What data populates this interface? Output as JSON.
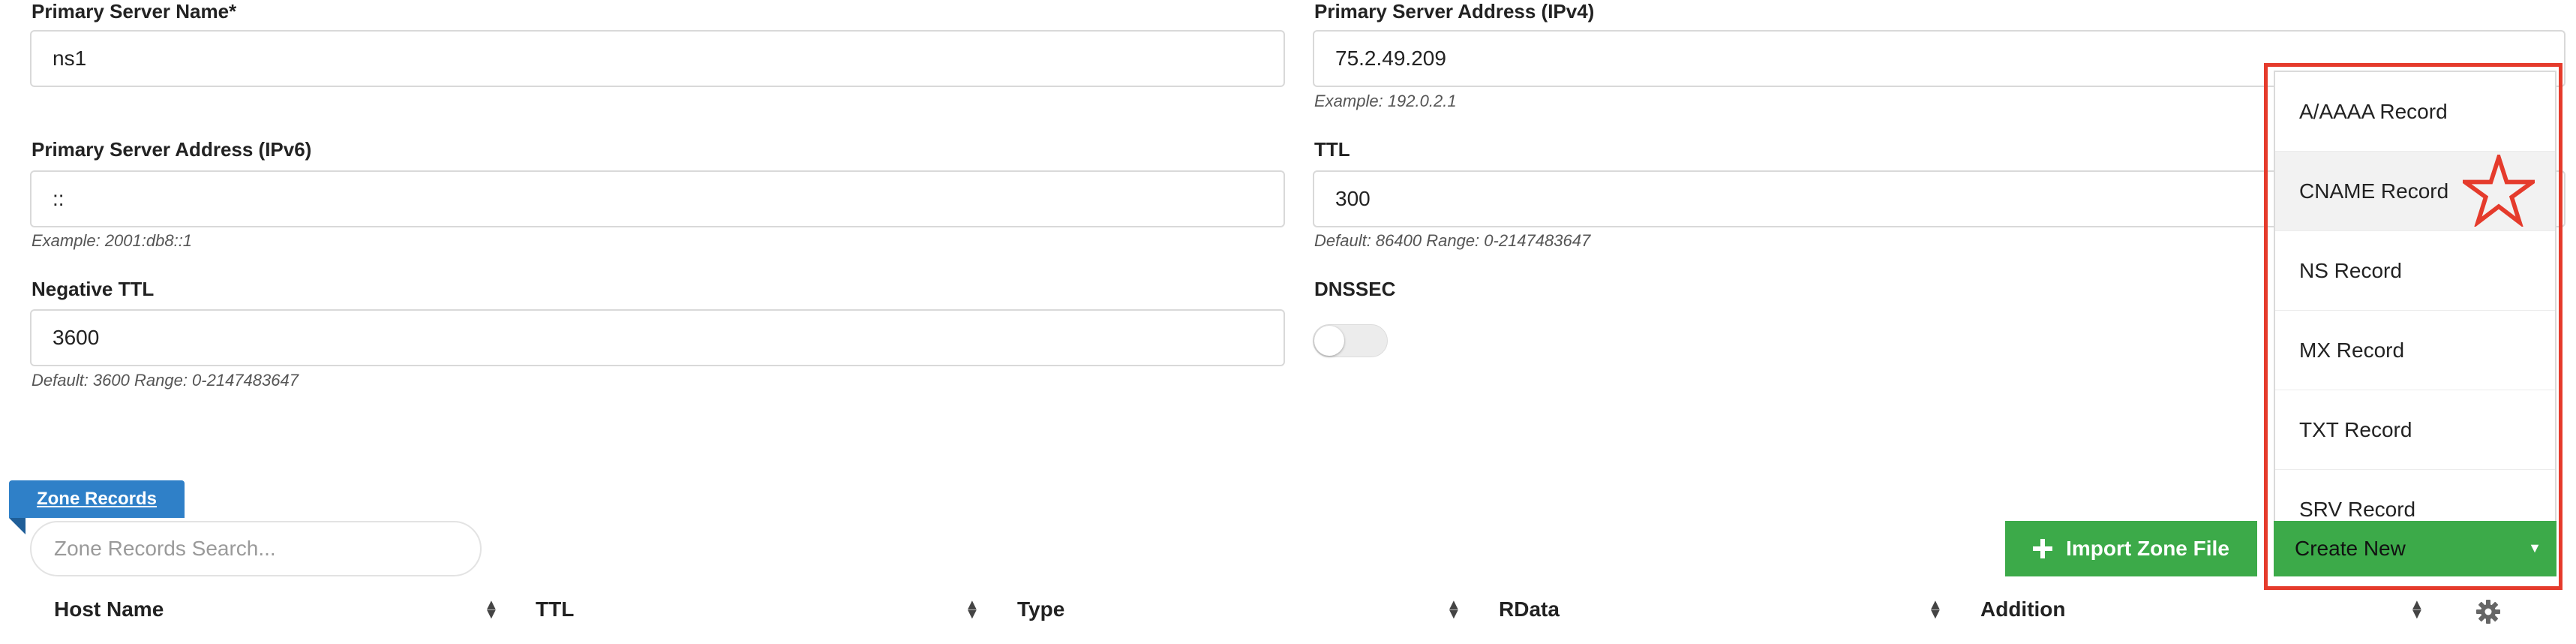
{
  "fields": {
    "primary_name": {
      "label": "Primary Server Name*",
      "value": "ns1"
    },
    "ipv4": {
      "label": "Primary Server Address (IPv4)",
      "value": "75.2.49.209",
      "hint": "Example: 192.0.2.1"
    },
    "ipv6": {
      "label": "Primary Server Address (IPv6)",
      "value": "::",
      "hint": "Example: 2001:db8::1"
    },
    "ttl": {
      "label": "TTL",
      "value": "300",
      "hint": "Default: 86400 Range: 0-2147483647"
    },
    "negative_ttl": {
      "label": "Negative TTL",
      "value": "3600",
      "hint": "Default: 3600 Range: 0-2147483647"
    },
    "dnssec": {
      "label": "DNSSEC",
      "enabled": false
    }
  },
  "zone_records": {
    "tab_label": "Zone Records",
    "search_placeholder": "Zone Records Search...",
    "import_button": "Import Zone File",
    "create_button": "Create New",
    "create_menu": [
      "A/AAAA Record",
      "CNAME Record",
      "NS Record",
      "MX Record",
      "TXT Record",
      "SRV Record"
    ],
    "columns": [
      "Host Name",
      "TTL",
      "Type",
      "RData",
      "Addition"
    ]
  },
  "colors": {
    "accent_blue": "#2f80c8",
    "button_green": "#3caa49",
    "highlight_red": "#e53b2c"
  },
  "icons": [
    "plus-icon",
    "caret-down-icon",
    "sort-icon",
    "gear-icon",
    "star-icon"
  ]
}
